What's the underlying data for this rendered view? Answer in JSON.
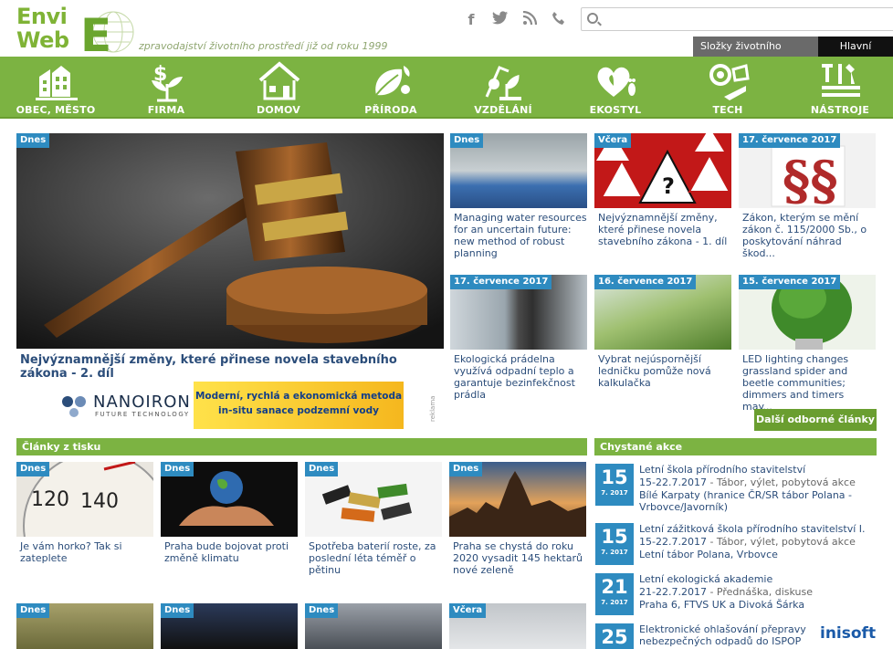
{
  "header": {
    "logo_line1": "Envi",
    "logo_line2": "Web",
    "tagline": "zpravodajství životního prostředí již od roku 1999",
    "search_placeholder": "",
    "tab_components": "Složky životního prostředí",
    "tab_main": "Hlavní témata",
    "socials": [
      "facebook-icon",
      "twitter-icon",
      "rss-icon",
      "phone-icon"
    ]
  },
  "nav": {
    "items": [
      {
        "label": "OBEC, MĚSTO",
        "icon": "city-icon"
      },
      {
        "label": "FIRMA",
        "icon": "money-plant-icon"
      },
      {
        "label": "DOMOV",
        "icon": "house-icon"
      },
      {
        "label": "PŘÍRODA",
        "icon": "nature-icon"
      },
      {
        "label": "VZDĚLÁNÍ",
        "icon": "education-icon"
      },
      {
        "label": "EKOSTYL",
        "icon": "heart-footprint-icon"
      },
      {
        "label": "TECH",
        "icon": "tech-icon"
      },
      {
        "label": "NÁSTROJE",
        "icon": "tools-icon"
      }
    ]
  },
  "main_article": {
    "badge": "Dnes",
    "title": "Nejvýznamnější změny, které přinese novela stavebního zákona - 2. díl"
  },
  "side_articles": [
    {
      "badge": "Dnes",
      "title": "Managing water resources for an uncertain future: new method of robust planning"
    },
    {
      "badge": "Včera",
      "title": "Nejvýznamnější změny, které přinese novela stavebního zákona - 1. díl"
    },
    {
      "badge": "17. července 2017",
      "title": "Zákon, kterým se mění zákon č. 115/2000 Sb., o poskytování náhrad škod..."
    },
    {
      "badge": "17. července 2017",
      "title": "Ekologická prádelna využívá odpadní teplo a garantuje bezinfekčnost prádla"
    },
    {
      "badge": "16. července 2017",
      "title": "Vybrat nejúspornější ledničku pomůže nová kalkulačka"
    },
    {
      "badge": "15. července 2017",
      "title": "LED lighting changes grassland spider and beetle communities; dimmers and timers may..."
    }
  ],
  "more_button": "Další odborné články",
  "banner": {
    "brand": "NANOIRON",
    "brand_sub": "FUTURE TECHNOLOGY",
    "text_line1": "Moderní, rychlá a ekonomická metoda",
    "text_line2": "in-situ sanace podzemní vody",
    "ad_label": "reklama"
  },
  "press": {
    "title": "Články z tisku",
    "items": [
      {
        "badge": "Dnes",
        "title": "Je vám horko? Tak si zateplete"
      },
      {
        "badge": "Dnes",
        "title": "Praha bude bojovat proti změně klimatu"
      },
      {
        "badge": "Dnes",
        "title": "Spotřeba baterií roste, za poslední léta téměř o pětinu"
      },
      {
        "badge": "Dnes",
        "title": "Praha se chystá do roku 2020 vysadit 145 hektarů nové zeleně"
      },
      {
        "badge": "Dnes",
        "title": ""
      },
      {
        "badge": "Dnes",
        "title": ""
      },
      {
        "badge": "Dnes",
        "title": ""
      },
      {
        "badge": "Včera",
        "title": ""
      }
    ]
  },
  "events": {
    "title": "Chystané akce",
    "items": [
      {
        "day": "15",
        "month": "7. 2017",
        "title": "Letní škola přírodního stavitelství",
        "dates": "15-22.7.2017",
        "type": " - Tábor, výlet, pobytová akce",
        "place": "Bílé Karpaty (hranice ČR/SR tábor Polana - Vrbovce/Javorník)"
      },
      {
        "day": "15",
        "month": "7. 2017",
        "title": "Letní zážitková škola přírodního stavitelství I.",
        "dates": "15-22.7.2017",
        "type": " - Tábor, výlet, pobytová akce",
        "place": "Letní tábor Polana, Vrbovce"
      },
      {
        "day": "21",
        "month": "7. 2017",
        "title": "Letní ekologická akademie",
        "dates": "21-22.7.2017",
        "type": " - Přednáška, diskuse",
        "place": "Praha 6, FTVS UK a Divoká Šárka"
      },
      {
        "day": "25",
        "month": "",
        "title": "Elektronické ohlašování přepravy nebezpečných odpadů do ISPOP",
        "dates": "",
        "type": "",
        "place": ""
      }
    ],
    "sponsor": "inisoft"
  }
}
